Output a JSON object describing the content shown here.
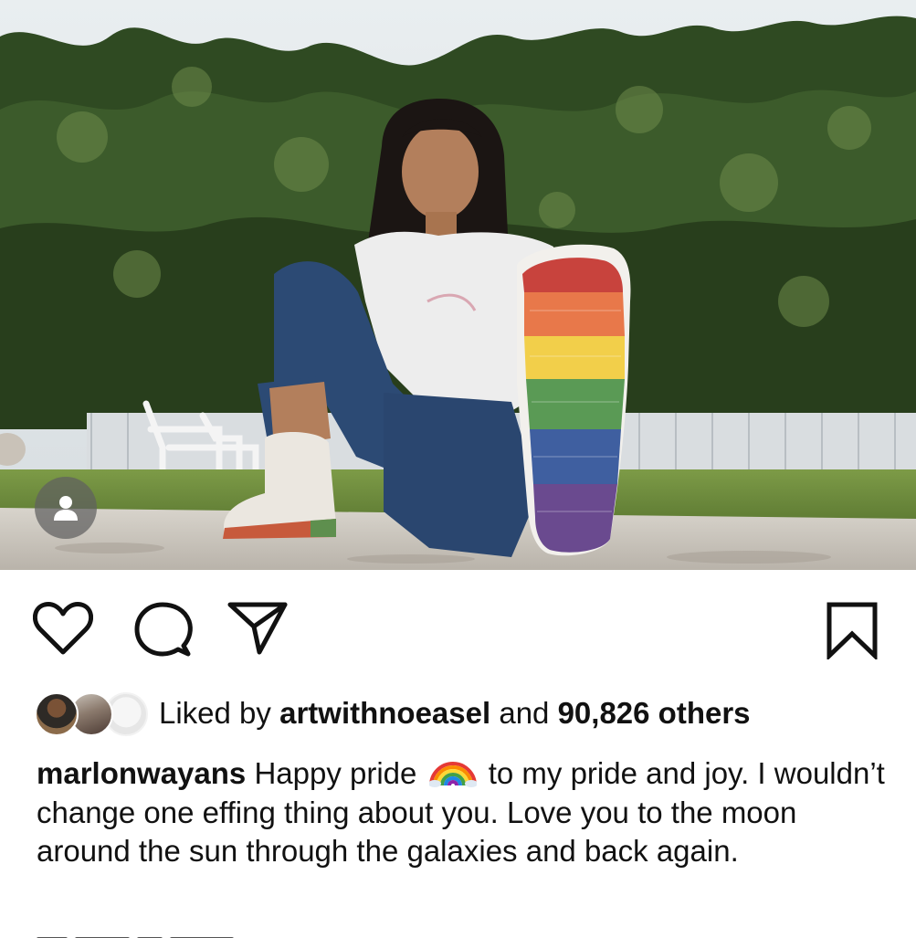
{
  "post": {
    "photo": {
      "tag_icon": "user-tag-icon"
    },
    "actions": {
      "like_icon": "heart-icon",
      "comment_icon": "speech-bubble-icon",
      "share_icon": "paper-plane-icon",
      "save_icon": "bookmark-icon"
    },
    "likes": {
      "prefix": "Liked by",
      "first_liker": "artwithnoeasel",
      "joiner": "and",
      "others_count": "90,826 others"
    },
    "caption": {
      "username": "marlonwayans",
      "text_before_emoji": "Happy pride",
      "emoji": "rainbow-emoji",
      "text_after_emoji": "to my pride and joy. I wouldn’t change one effing thing about you. Love you to the moon around the sun through the galaxies and back again."
    }
  }
}
